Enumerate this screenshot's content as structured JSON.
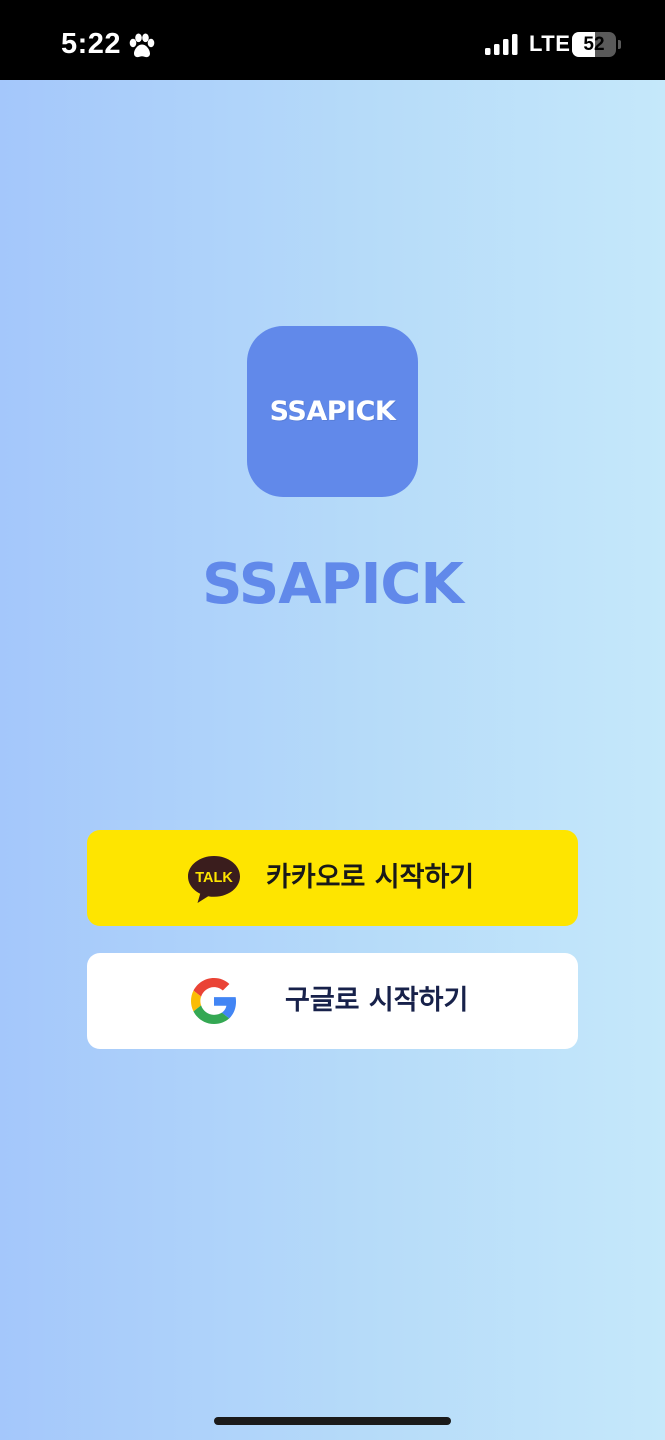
{
  "status_bar": {
    "time": "5:22",
    "network": "LTE",
    "battery_level": "52",
    "battery_fraction": 0.52
  },
  "app": {
    "icon_label": "SSAPICK",
    "title": "SSAPICK",
    "brand_color": "#6189ea"
  },
  "buttons": {
    "kakao": {
      "label": "카카오로 시작하기",
      "icon_text": "TALK",
      "background": "#fee500"
    },
    "google": {
      "label": "구글로 시작하기",
      "background": "#ffffff"
    }
  },
  "icons": {
    "status": [
      "paw-icon",
      "signal-icon",
      "battery-icon"
    ],
    "buttons": [
      "kakao-talk-icon",
      "google-icon"
    ]
  }
}
